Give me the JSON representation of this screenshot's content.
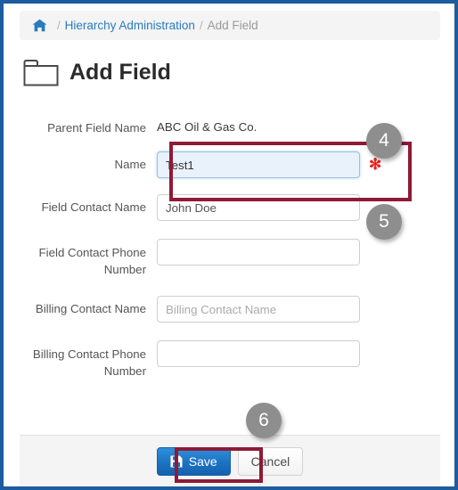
{
  "window": {
    "border_color": "#1d5c9e"
  },
  "breadcrumb": {
    "home_icon": "home-icon",
    "separator": "/",
    "link_label": "Hierarchy Administration",
    "current_label": "Add Field"
  },
  "header": {
    "icon": "folder-icon",
    "title": "Add Field"
  },
  "form": {
    "rows": [
      {
        "label": "Parent Field Name",
        "type": "static",
        "value": "ABC Oil & Gas Co.",
        "required": false
      },
      {
        "label": "Name",
        "type": "input",
        "value": "Test1",
        "placeholder": "",
        "focused": true,
        "required": true
      },
      {
        "label": "Field Contact Name",
        "type": "input",
        "value": "John Doe",
        "placeholder": "Field Contact Name",
        "focused": false,
        "required": false
      },
      {
        "label": "Field Contact Phone Number",
        "type": "input",
        "value": "",
        "placeholder": "",
        "focused": false,
        "required": false
      },
      {
        "label": "Billing Contact Name",
        "type": "input",
        "value": "",
        "placeholder": "Billing Contact Name",
        "focused": false,
        "required": false
      },
      {
        "label": "Billing Contact Phone Number",
        "type": "input",
        "value": "",
        "placeholder": "",
        "focused": false,
        "required": false
      }
    ],
    "required_marker": "✻"
  },
  "footer": {
    "save_label": "Save",
    "save_icon": "floppy-disk-icon",
    "cancel_label": "Cancel"
  },
  "annotations": {
    "accent_color": "#8e1a37",
    "badge_color": "#8e8e8e",
    "badges": [
      {
        "number": "4"
      },
      {
        "number": "5"
      },
      {
        "number": "6"
      }
    ]
  }
}
